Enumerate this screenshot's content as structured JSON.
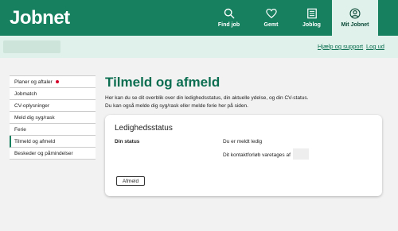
{
  "header": {
    "logo": "Jobnet",
    "nav": [
      {
        "label": "Find job",
        "icon": "search-icon"
      },
      {
        "label": "Gemt",
        "icon": "heart-icon"
      },
      {
        "label": "Joblog",
        "icon": "list-icon"
      },
      {
        "label": "Mit Jobnet",
        "icon": "user-icon",
        "active": true
      }
    ]
  },
  "subbar": {
    "help_label": "Hjælp og support",
    "logout_label": "Log ud"
  },
  "sidebar": {
    "items": [
      {
        "label": "Planer og aftaler",
        "notification": true
      },
      {
        "label": "Jobmatch"
      },
      {
        "label": "CV-oplysninger"
      },
      {
        "label": "Meld dig syg/rask"
      },
      {
        "label": "Ferie"
      },
      {
        "label": "Tilmeld og afmeld",
        "active": true
      },
      {
        "label": "Beskeder og påmindelser"
      }
    ]
  },
  "main": {
    "title": "Tilmeld og afmeld",
    "intro_line1": "Her kan du se dit overblik over din ledighedsstatus, din aktuelle ydelse, og din CV-status.",
    "intro_line2": "Du kan også melde dig syg/rask eller melde ferie her på siden.",
    "card": {
      "title": "Ledighedsstatus",
      "status_label": "Din status",
      "status_value": "Du er meldt ledig",
      "contact_text": "Dit kontaktforløb varetages af",
      "button_label": "Afmeld"
    }
  },
  "colors": {
    "brand_green": "#16805f",
    "light_green": "#dff1ea",
    "notification_red": "#d4002a"
  }
}
